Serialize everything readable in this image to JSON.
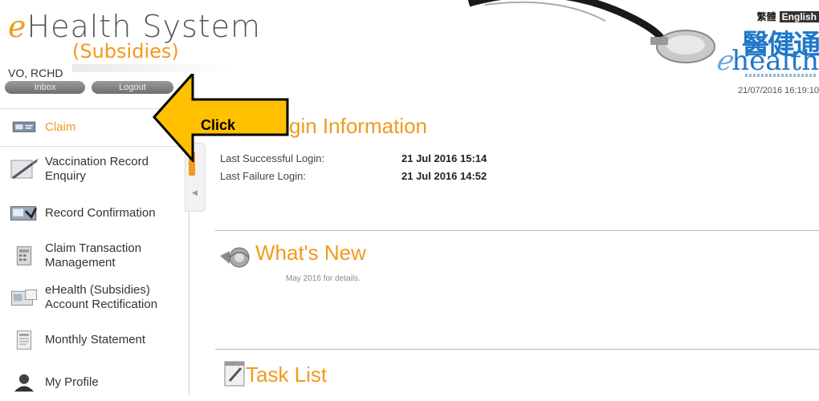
{
  "header": {
    "logo_prefix": "ℯ",
    "logo_main": "Health System",
    "logo_sub": "(Subsidies)",
    "user_name": "VO, RCHD",
    "inbox_label": "Inbox",
    "logout_label": "Logout",
    "lang_zh": "繁體",
    "lang_en": "English",
    "brand_zh": "醫健通",
    "brand_en_prefix": "ℯ",
    "brand_en": "health",
    "datetime": "21/07/2016 16:19:10"
  },
  "sidebar": {
    "items": [
      {
        "label": "Claim",
        "active": true
      },
      {
        "label": "Vaccination Record Enquiry"
      },
      {
        "label": "Record Confirmation"
      },
      {
        "label": "Claim Transaction Management"
      },
      {
        "label": "eHealth (Subsidies) Account Rectification"
      },
      {
        "label": "Monthly Statement"
      },
      {
        "label": "My Profile"
      }
    ]
  },
  "main": {
    "login_title": "gin Information",
    "last_success_label": "Last Successful Login:",
    "last_success_value": "21 Jul 2016 15:14",
    "last_failure_label": "Last Failure Login:",
    "last_failure_value": "21 Jul 2016 14:52",
    "whats_new_title": "What's New",
    "whats_new_cut": "May 2016 for details.",
    "task_list_title": "Task List"
  },
  "callout": {
    "text": "Click",
    "fill_color": "#ffc000",
    "stroke_color": "#000000"
  },
  "colors": {
    "accent": "#f19a1d",
    "brand_blue": "#2078c8"
  }
}
